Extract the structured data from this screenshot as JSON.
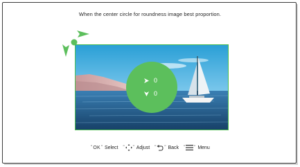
{
  "instruction": "When the center circle for roundness image best proportion.",
  "indicator": {
    "horizontal_value": "0",
    "vertical_value": "0"
  },
  "hints": [
    {
      "key": "OK",
      "label": "Select"
    },
    {
      "key_icon": "arrows-cross-icon",
      "label": "Adjust"
    },
    {
      "key_icon": "back-arrow-icon",
      "label": "Back"
    },
    {
      "key_icon": "menu-icon",
      "label": "Menu"
    }
  ],
  "colors": {
    "accent": "#5cbf5c",
    "border": "#4fbf4f"
  }
}
